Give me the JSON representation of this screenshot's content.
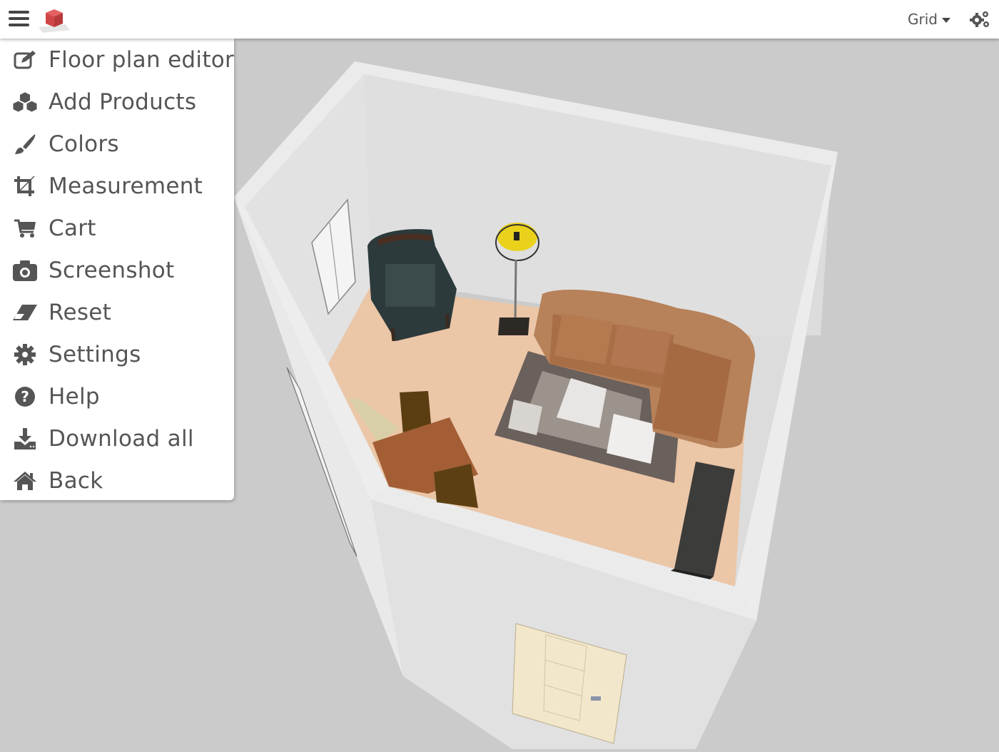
{
  "topbar": {
    "menu_icon": "hamburger-icon",
    "logo_icon": "red-cube-logo",
    "view_dropdown": {
      "selected": "Grid"
    },
    "settings_icon": "gears-icon"
  },
  "menu": {
    "items": [
      {
        "label": "Floor plan editor",
        "icon": "edit-icon"
      },
      {
        "label": "Add Products",
        "icon": "cubes-icon"
      },
      {
        "label": "Colors",
        "icon": "paint-brush-icon"
      },
      {
        "label": "Measurement",
        "icon": "crop-icon"
      },
      {
        "label": "Cart",
        "icon": "cart-icon"
      },
      {
        "label": "Screenshot",
        "icon": "camera-icon"
      },
      {
        "label": "Reset",
        "icon": "eraser-icon"
      },
      {
        "label": "Settings",
        "icon": "cog-icon"
      },
      {
        "label": "Help",
        "icon": "question-circle-icon"
      },
      {
        "label": "Download all",
        "icon": "download-icon"
      },
      {
        "label": "Back",
        "icon": "home-icon"
      }
    ]
  },
  "scene": {
    "objects": [
      "window",
      "armchair",
      "floor-lamp",
      "chesterfield-sofa",
      "cowhide-rug",
      "dining-table",
      "dining-chairs",
      "cabinet",
      "door"
    ],
    "colors": {
      "background": "#cbcbcb",
      "wall": "#e8e8e8",
      "floor": "#ebc3a3",
      "sofa": "#b9835a",
      "armchair": "#2c3a3c",
      "lamp_shade": "#e8d020",
      "door": "#f1e6c8",
      "table": "#a0603a"
    }
  }
}
